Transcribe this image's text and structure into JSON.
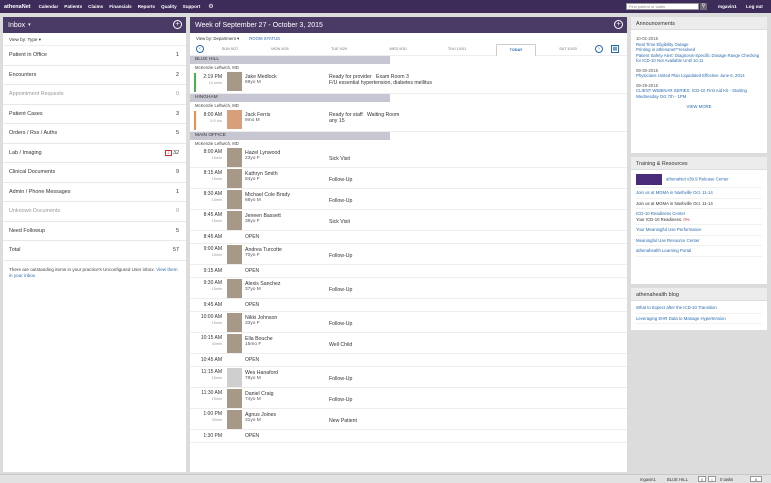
{
  "topbar": {
    "brand": "athenaNet",
    "nav": [
      "Calendar",
      "Patients",
      "Claims",
      "Financials",
      "Reports",
      "Quality",
      "Support"
    ],
    "search_placeholder": "Find patient or claim",
    "user": "mgavin1",
    "logout": "Log out"
  },
  "inbox": {
    "title": "Inbox",
    "filter": "View by: Type",
    "rows": [
      {
        "label": "Patient in Office",
        "count": "1"
      },
      {
        "label": "Encounters",
        "count": "2"
      },
      {
        "label": "Appointment Requests",
        "count": "0"
      },
      {
        "label": "Patient Cases",
        "count": "3"
      },
      {
        "label": "Orders / Rxs / Auths",
        "count": "5"
      },
      {
        "label": "Lab / Imaging",
        "count": "32",
        "flag": "2"
      },
      {
        "label": "Clinical Documents",
        "count": "9"
      },
      {
        "label": "Admin / Phone Messages",
        "count": "1"
      },
      {
        "label": "Unknown Documents",
        "count": "0"
      },
      {
        "label": "Need Followup",
        "count": "5"
      },
      {
        "label": "Total",
        "count": "57"
      }
    ],
    "note": "There are outstanding items in your practice's Unconfigured User inbox.",
    "note_link": "View them in your inbox"
  },
  "schedule": {
    "title": "Week of September 27 - October 3, 2015",
    "view_by": "View by: Department",
    "room_status": "ROOM STATUS",
    "days": [
      "SUN 9/27",
      "MON 9/28",
      "TUE 9/29",
      "WED 9/30",
      "THU 10/01",
      "TODAY",
      "SAT 10/03"
    ],
    "dept1": "BLUE HILL",
    "prov1": "McKenzie Leftwich, MD",
    "a1": {
      "time": "2:19 PM",
      "dur": "14 mins",
      "name": "Jake Medlock",
      "age": "69yo M",
      "status": "Ready for provider",
      "room": "Exam Room 3",
      "reason": "F/U essential hypertension, diabetes mellitus"
    },
    "dept2": "HINGHAM",
    "prov2": "McKenzie Leftwich, MD",
    "a2": {
      "time": "8:00 AM",
      "dur": "5.5 hrs",
      "name": "Jack Ferris",
      "age": "9mo M",
      "status": "Ready for staff",
      "room": "Waiting Room",
      "reason": "any 15"
    },
    "dept3": "MAIN OFFICE",
    "prov3": "McKenzie Leftwich, MD",
    "appts": [
      {
        "time": "8:00 AM",
        "dur": "15min",
        "name": "Hazel Lynwood",
        "age": "23yo F",
        "visit": "Sick Visit"
      },
      {
        "time": "8:15 AM",
        "dur": "15min",
        "name": "Kathryn Smith",
        "age": "84yo F",
        "visit": "Follow-Up"
      },
      {
        "time": "8:30 AM",
        "dur": "15min",
        "name": "Michael Cole Brady",
        "age": "68yo M",
        "visit": "Follow-Up"
      },
      {
        "time": "8:45 AM",
        "dur": "15min",
        "name": "Jeneen Bassett",
        "age": "38yo F",
        "visit": "Sick Visit"
      },
      {
        "time": "8:45 AM",
        "open": "OPEN"
      },
      {
        "time": "9:00 AM",
        "dur": "15min",
        "name": "Andrea Turcotte",
        "age": "70yo F",
        "visit": "Follow-Up"
      },
      {
        "time": "9:15 AM",
        "open": "OPEN"
      },
      {
        "time": "9:30 AM",
        "dur": "15min",
        "name": "Alexis Sanchez",
        "age": "37yo M",
        "visit": "Follow-Up"
      },
      {
        "time": "9:45 AM",
        "open": "OPEN"
      },
      {
        "time": "10:00 AM",
        "dur": "15min",
        "name": "Nikki Johnson",
        "age": "33yo F",
        "visit": "Follow-Up"
      },
      {
        "time": "10:15 AM",
        "dur": "30min",
        "name": "Ella Bouche",
        "age": "15mo F",
        "visit": "Well Child"
      },
      {
        "time": "10:45 AM",
        "open": "OPEN"
      },
      {
        "time": "11:15 AM",
        "dur": "15min",
        "name": "Wes Hanaford",
        "age": "78yo M",
        "visit": "Follow-Up",
        "nophoto": true
      },
      {
        "time": "11:30 AM",
        "dur": "15min",
        "name": "Daniel Craig",
        "age": "74yo M",
        "visit": "Follow-Up"
      },
      {
        "time": "1:00 PM",
        "dur": "30min",
        "name": "Agnus Joines",
        "age": "31yo M",
        "visit": "New Patient"
      },
      {
        "time": "1:30 PM",
        "open": "OPEN"
      }
    ]
  },
  "announcements": {
    "title": "Announcements",
    "items": [
      {
        "date": "10-01-2015",
        "links": [
          "Real Time Eligibility Outage",
          "Printing in athenanet**resolved",
          "Patient Safety Alert: Diagnosis-Specific Dosage Range Checking for ICD-10 Not Available Until 10.11"
        ]
      },
      {
        "date": "09-30-2015",
        "links": [
          "Physicians United Plan Liquidated Effective June 6, 2014"
        ]
      },
      {
        "date": "09-29-2015",
        "links": [
          "CLIENT WEBINAR SERIES: ICD-10 First Aid Kit - Starting Wednesday Oct 7th - 1PM"
        ]
      }
    ],
    "view_more": "VIEW MORE"
  },
  "training": {
    "title": "Training & Resources",
    "release": "athenaNet v39.9 Release Center",
    "items": [
      "Join us at MGMA in Nashville Oct. 11-14",
      "Join us at MGMA in Nashville Oct. 11-14"
    ],
    "icd": "ICD-10 Readiness Center",
    "readiness_label": "Your ICD-10 Readiness:",
    "readiness_value": "0%",
    "links": [
      "Your Meaningful Use Performance",
      "Meaningful Use Resource Center",
      "athenahealth Learning Portal"
    ]
  },
  "blog": {
    "title": "athenahealth blog",
    "links": [
      "What to Expect after the ICD-10 Transition",
      "Leveraging EHR Data to Manage Hypertension"
    ]
  },
  "footer": {
    "user": "mgavin1",
    "dept": "BLUE HILL",
    "count1": "0",
    "count2": "0",
    "tasks": "0 tasks",
    "count3": "0"
  }
}
